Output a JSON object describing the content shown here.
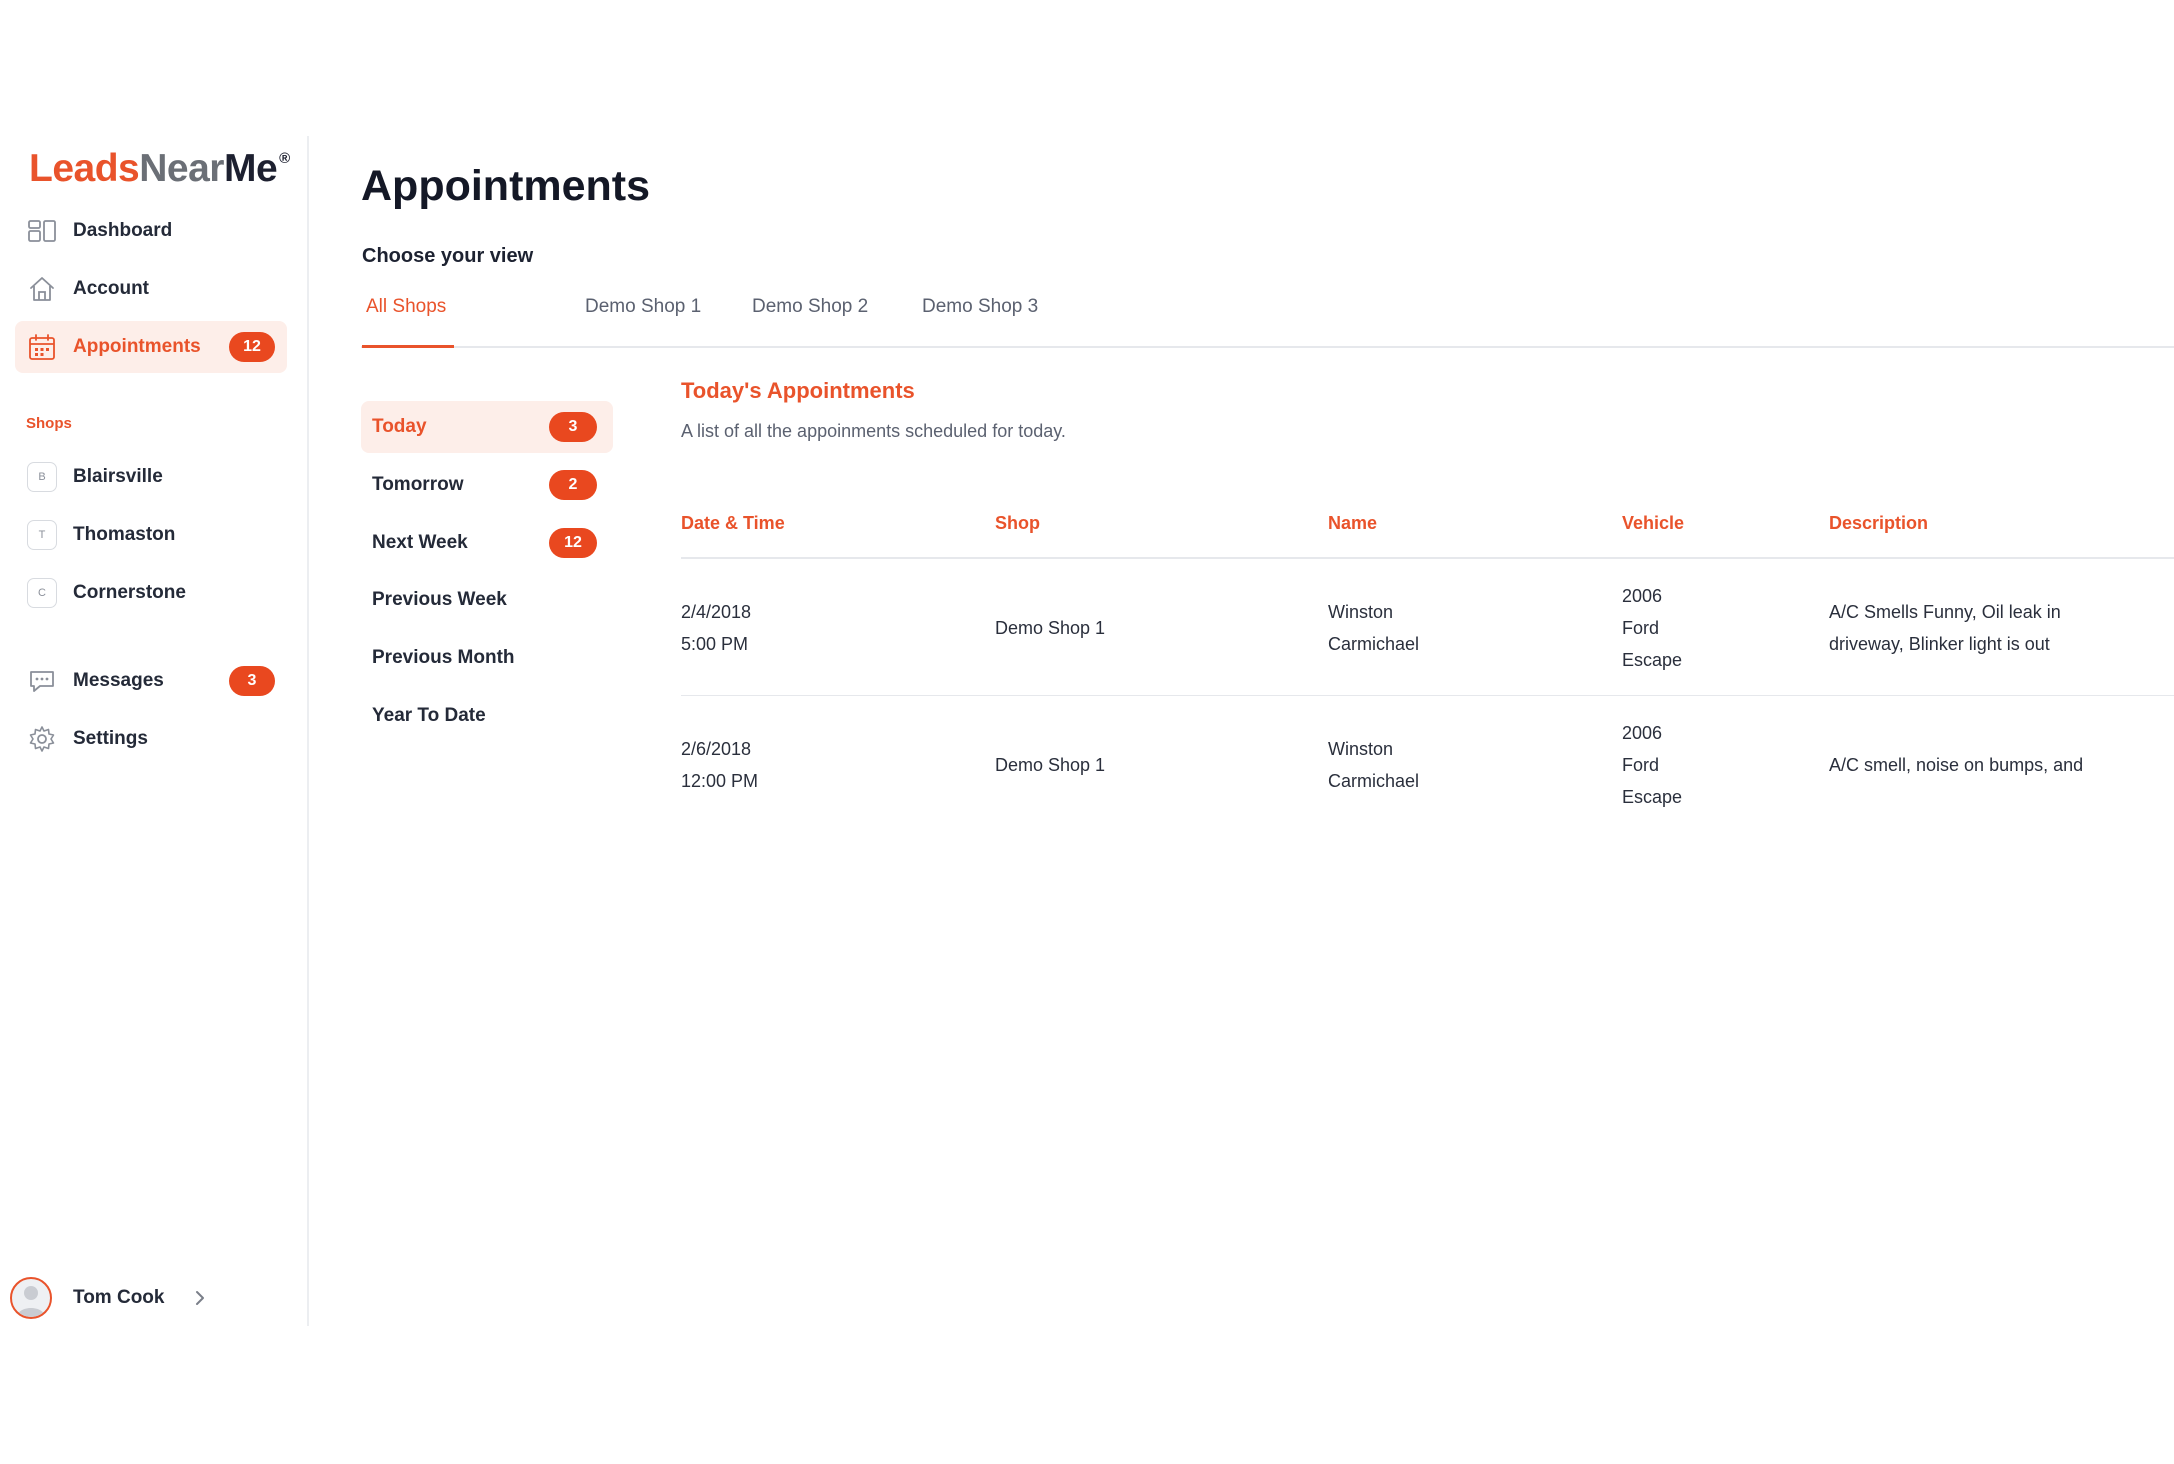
{
  "logo": {
    "part1": "Leads",
    "part2": "Near",
    "part3": "Me",
    "reg": "®"
  },
  "colors": {
    "accent": "#e9532b",
    "badge": "#e9481f",
    "active_bg": "#fdeee9"
  },
  "nav": {
    "items": [
      {
        "label": "Dashboard",
        "icon": "dashboard-icon"
      },
      {
        "label": "Account",
        "icon": "home-icon"
      },
      {
        "label": "Appointments",
        "icon": "calendar-icon",
        "badge": "12",
        "active": true
      }
    ],
    "shops_label": "Shops",
    "shops": [
      {
        "initial": "B",
        "name": "Blairsville"
      },
      {
        "initial": "T",
        "name": "Thomaston"
      },
      {
        "initial": "C",
        "name": "Cornerstone"
      }
    ],
    "bottom_items": [
      {
        "label": "Messages",
        "icon": "chat-icon",
        "badge": "3"
      },
      {
        "label": "Settings",
        "icon": "gear-icon"
      }
    ]
  },
  "user": {
    "name": "Tom Cook"
  },
  "main": {
    "title": "Appointments",
    "choose_view": "Choose your view",
    "tabs": [
      "All Shops",
      "Demo Shop 1",
      "Demo Shop 2",
      "Demo Shop 3"
    ],
    "active_tab": "All Shops",
    "filters": [
      {
        "label": "Today",
        "badge": "3",
        "active": true
      },
      {
        "label": "Tomorrow",
        "badge": "2"
      },
      {
        "label": "Next Week",
        "badge": "12"
      },
      {
        "label": "Previous Week"
      },
      {
        "label": "Previous Month"
      },
      {
        "label": "Year To Date"
      }
    ],
    "list_title": "Today's Appointments",
    "list_subtitle": "A list of all the appoinments scheduled for today.",
    "columns": [
      "Date & Time",
      "Shop",
      "Name",
      "Vehicle",
      "Description"
    ],
    "rows": [
      {
        "date": "2/4/2018",
        "time": "5:00 PM",
        "shop": "Demo Shop 1",
        "name1": "Winston",
        "name2": "Carmichael",
        "v1": "2006",
        "v2": "Ford",
        "v3": "Escape",
        "desc1": "A/C Smells Funny, Oil leak in",
        "desc2": "driveway, Blinker light is out"
      },
      {
        "date": "2/6/2018",
        "time": "12:00 PM",
        "shop": "Demo Shop 1",
        "name1": "Winston",
        "name2": "Carmichael",
        "v1": "2006",
        "v2": "Ford",
        "v3": "Escape",
        "desc1": "A/C smell, noise on bumps, and"
      }
    ]
  }
}
